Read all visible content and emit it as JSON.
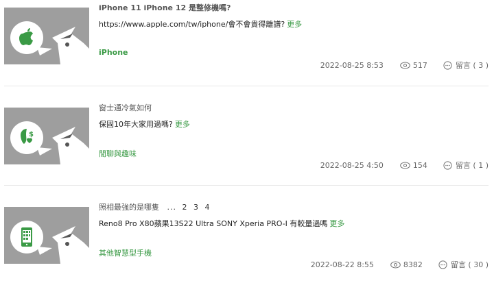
{
  "posts": [
    {
      "title": "iPhone 11 iPhone 12 是整修機嗎?",
      "excerpt": "https://www.apple.com/tw/iphone/會不會貴得離譜?",
      "more_label": "更多",
      "category": "iPhone",
      "date": "2022-08-25 8:53",
      "views": "517",
      "comments": "留言 ( 3 )",
      "thumb_icon": "apple-logo-icon"
    },
    {
      "title": "窗士通冷氣如何",
      "excerpt": "保固10年大家用過嗎?",
      "more_label": "更多",
      "category": "閒聊與趣味",
      "date": "2022-08-25 4:50",
      "views": "154",
      "comments": "留言 ( 1 )",
      "thumb_icon": "chat-money-icon"
    },
    {
      "title": "照相最強的是哪隻",
      "pagination": {
        "ellipsis": "...",
        "pages": [
          "2",
          "3",
          "4"
        ]
      },
      "excerpt": "Reno8 Pro X80蘋果13S22 Ultra SONY Xperia PRO-I 有較量過嗎",
      "more_label": "更多",
      "category": "其他智慧型手機",
      "date": "2022-08-22 8:55",
      "views": "8382",
      "comments": "留言 ( 30 )",
      "thumb_icon": "smartphone-icon"
    }
  ],
  "colors": {
    "accent_green": "#3a9a45",
    "thumb_gray": "#9e9e9e",
    "meta_gray": "#666666"
  }
}
